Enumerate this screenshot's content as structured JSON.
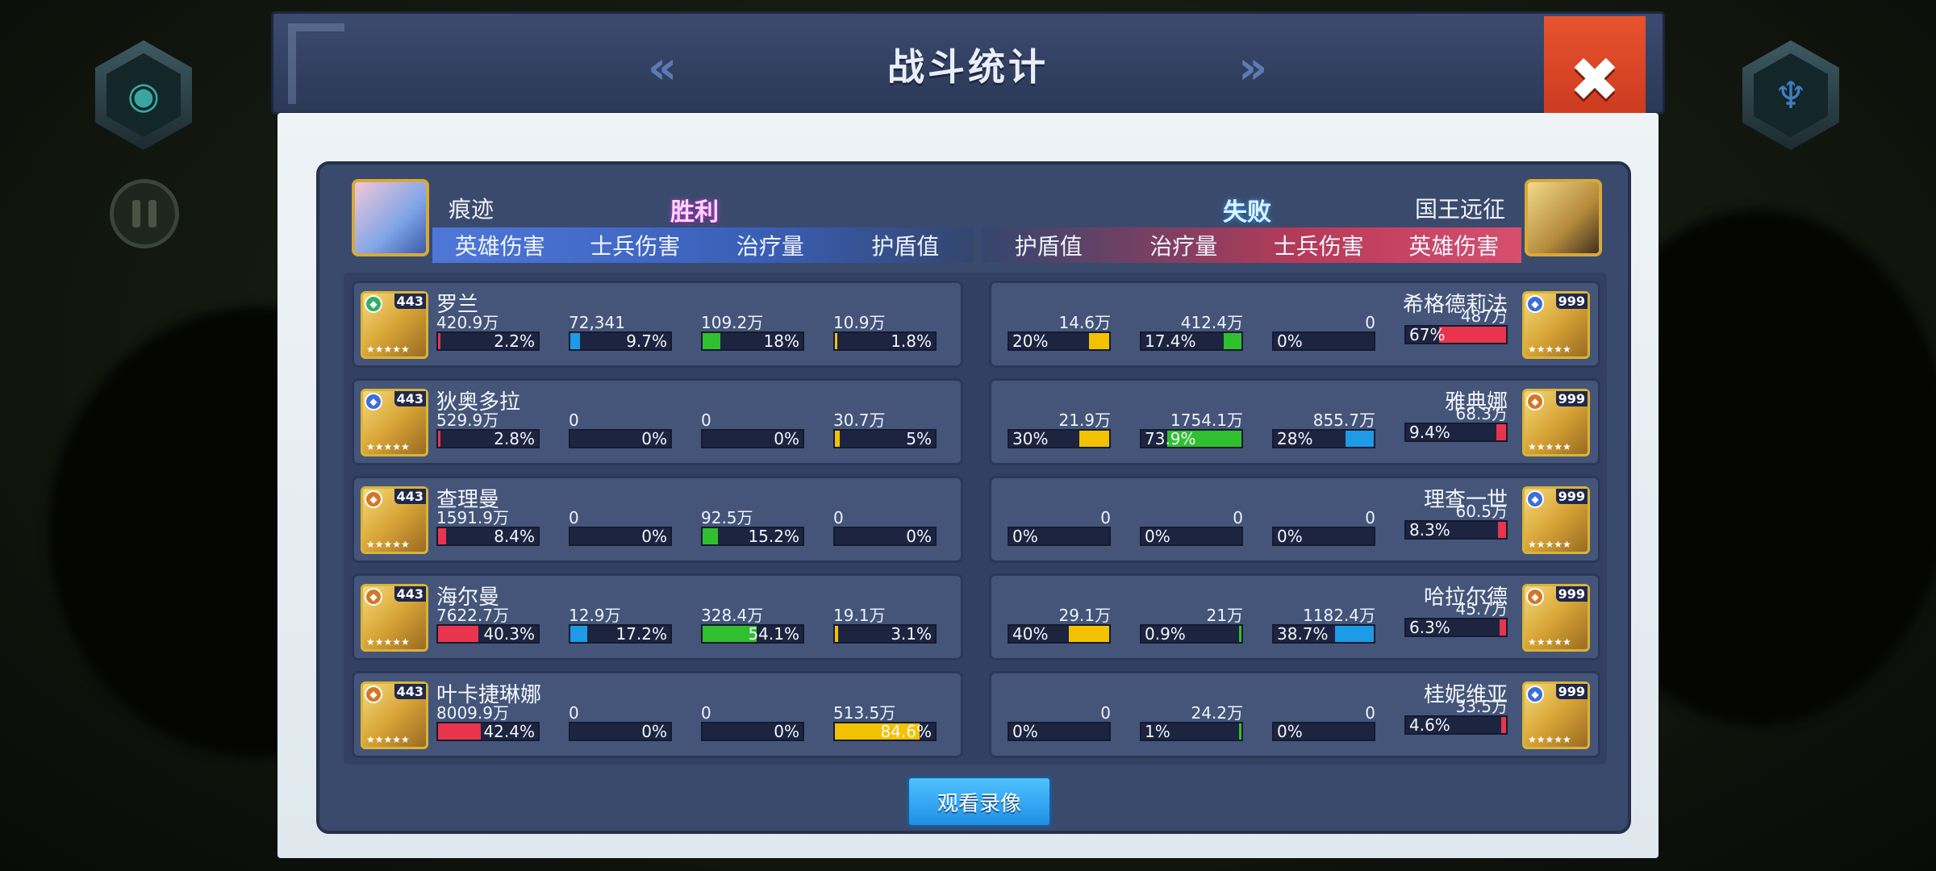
{
  "dialog": {
    "title": "战斗统计",
    "prev_icon": "double-chevron-left-icon",
    "next_icon": "double-chevron-right-icon",
    "close_icon": "close-icon",
    "watch_button": "观看录像"
  },
  "left_team": {
    "name": "痕迹",
    "result": "胜利",
    "columns": [
      "英雄伤害",
      "士兵伤害",
      "治疗量",
      "护盾值"
    ]
  },
  "right_team": {
    "name": "国王远征",
    "result": "失败",
    "columns": [
      "护盾值",
      "治疗量",
      "士兵伤害",
      "英雄伤害"
    ]
  },
  "colors": {
    "hero_damage": "#e8344c",
    "soldier_damage": "#1e9be6",
    "healing": "#2fbf2f",
    "shield": "#f2c200"
  },
  "left_heroes": [
    {
      "name": "罗兰",
      "level": "443",
      "stats": [
        [
          "420.9万",
          "2.2%",
          0.022
        ],
        [
          "72,341",
          "9.7%",
          0.097
        ],
        [
          "109.2万",
          "18%",
          0.18
        ],
        [
          "10.9万",
          "1.8%",
          0.018
        ]
      ]
    },
    {
      "name": "狄奥多拉",
      "level": "443",
      "stats": [
        [
          "529.9万",
          "2.8%",
          0.028
        ],
        [
          "0",
          "0%",
          0
        ],
        [
          "0",
          "0%",
          0
        ],
        [
          "30.7万",
          "5%",
          0.05
        ]
      ]
    },
    {
      "name": "查理曼",
      "level": "443",
      "stats": [
        [
          "1591.9万",
          "8.4%",
          0.084
        ],
        [
          "0",
          "0%",
          0
        ],
        [
          "92.5万",
          "15.2%",
          0.152
        ],
        [
          "0",
          "0%",
          0
        ]
      ]
    },
    {
      "name": "海尔曼",
      "level": "443",
      "stats": [
        [
          "7622.7万",
          "40.3%",
          0.403
        ],
        [
          "12.9万",
          "17.2%",
          0.172
        ],
        [
          "328.4万",
          "54.1%",
          0.541
        ],
        [
          "19.1万",
          "3.1%",
          0.031
        ]
      ]
    },
    {
      "name": "叶卡捷琳娜",
      "level": "443",
      "stats": [
        [
          "8009.9万",
          "42.4%",
          0.424
        ],
        [
          "0",
          "0%",
          0
        ],
        [
          "0",
          "0%",
          0
        ],
        [
          "513.5万",
          "84.6%",
          0.846
        ]
      ]
    }
  ],
  "right_heroes": [
    {
      "name": "希格德莉法",
      "level": "999",
      "stats": [
        [
          "14.6万",
          "20%",
          0.2
        ],
        [
          "412.4万",
          "17.4%",
          0.174
        ],
        [
          "0",
          "0%",
          0
        ],
        [
          "487万",
          "67%",
          0.67
        ]
      ]
    },
    {
      "name": "雅典娜",
      "level": "999",
      "stats": [
        [
          "21.9万",
          "30%",
          0.3
        ],
        [
          "1754.1万",
          "73.9%",
          0.739
        ],
        [
          "855.7万",
          "28%",
          0.28
        ],
        [
          "68.3万",
          "9.4%",
          0.094
        ]
      ]
    },
    {
      "name": "理查一世",
      "level": "999",
      "stats": [
        [
          "0",
          "0%",
          0
        ],
        [
          "0",
          "0%",
          0
        ],
        [
          "0",
          "0%",
          0
        ],
        [
          "60.5万",
          "8.3%",
          0.083
        ]
      ]
    },
    {
      "name": "哈拉尔德",
      "level": "999",
      "stats": [
        [
          "29.1万",
          "40%",
          0.4
        ],
        [
          "21万",
          "0.9%",
          0.009
        ],
        [
          "1182.4万",
          "38.7%",
          0.387
        ],
        [
          "45.7万",
          "6.3%",
          0.063
        ]
      ]
    },
    {
      "name": "桂妮维亚",
      "level": "999",
      "stats": [
        [
          "0",
          "0%",
          0
        ],
        [
          "24.2万",
          "1%",
          0.01
        ],
        [
          "0",
          "0%",
          0
        ],
        [
          "33.5万",
          "4.6%",
          0.046
        ]
      ]
    }
  ]
}
